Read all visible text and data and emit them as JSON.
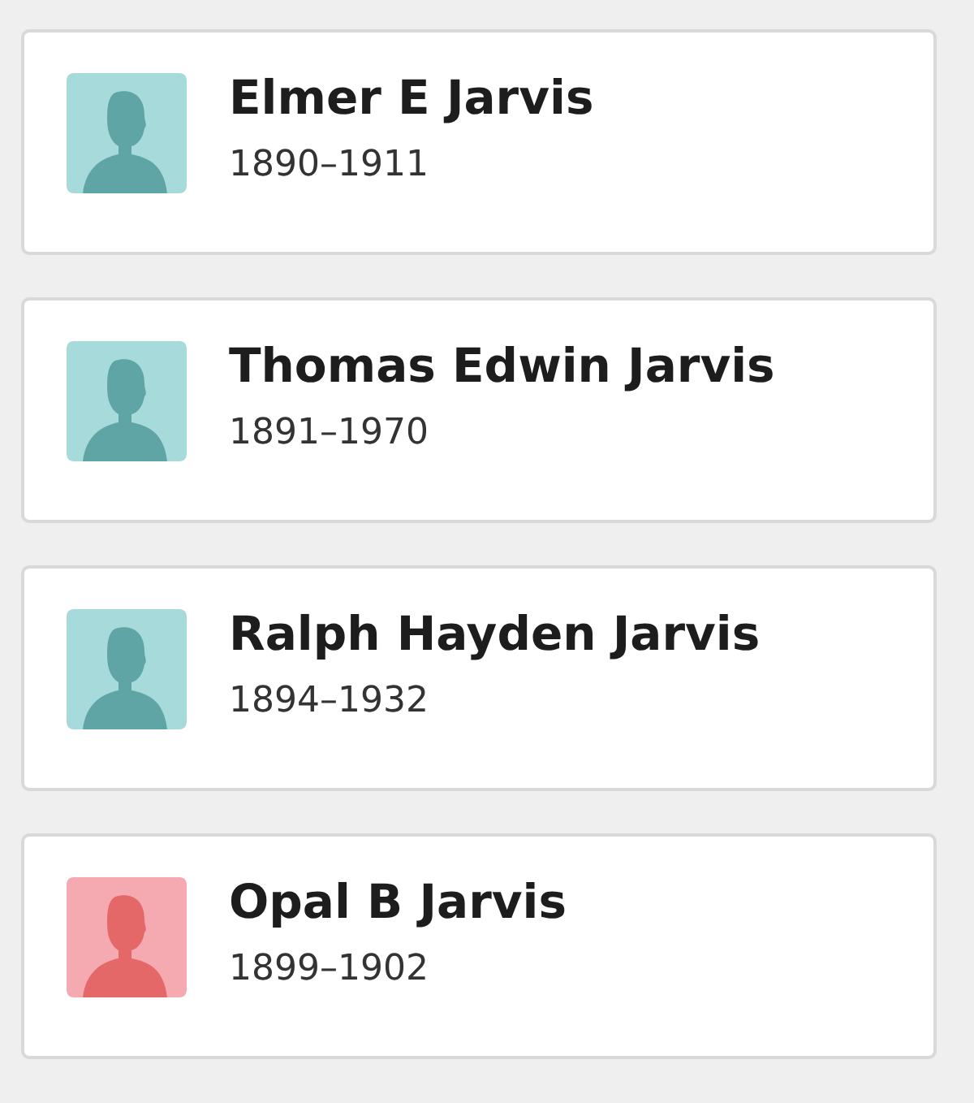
{
  "people": [
    {
      "name": "Elmer E Jarvis",
      "years": "1890–1911",
      "kind": "male"
    },
    {
      "name": "Thomas Edwin Jarvis",
      "years": "1891–1970",
      "kind": "male"
    },
    {
      "name": "Ralph Hayden Jarvis",
      "years": "1894–1932",
      "kind": "male"
    },
    {
      "name": "Opal B Jarvis",
      "years": "1899–1902",
      "kind": "female"
    }
  ]
}
